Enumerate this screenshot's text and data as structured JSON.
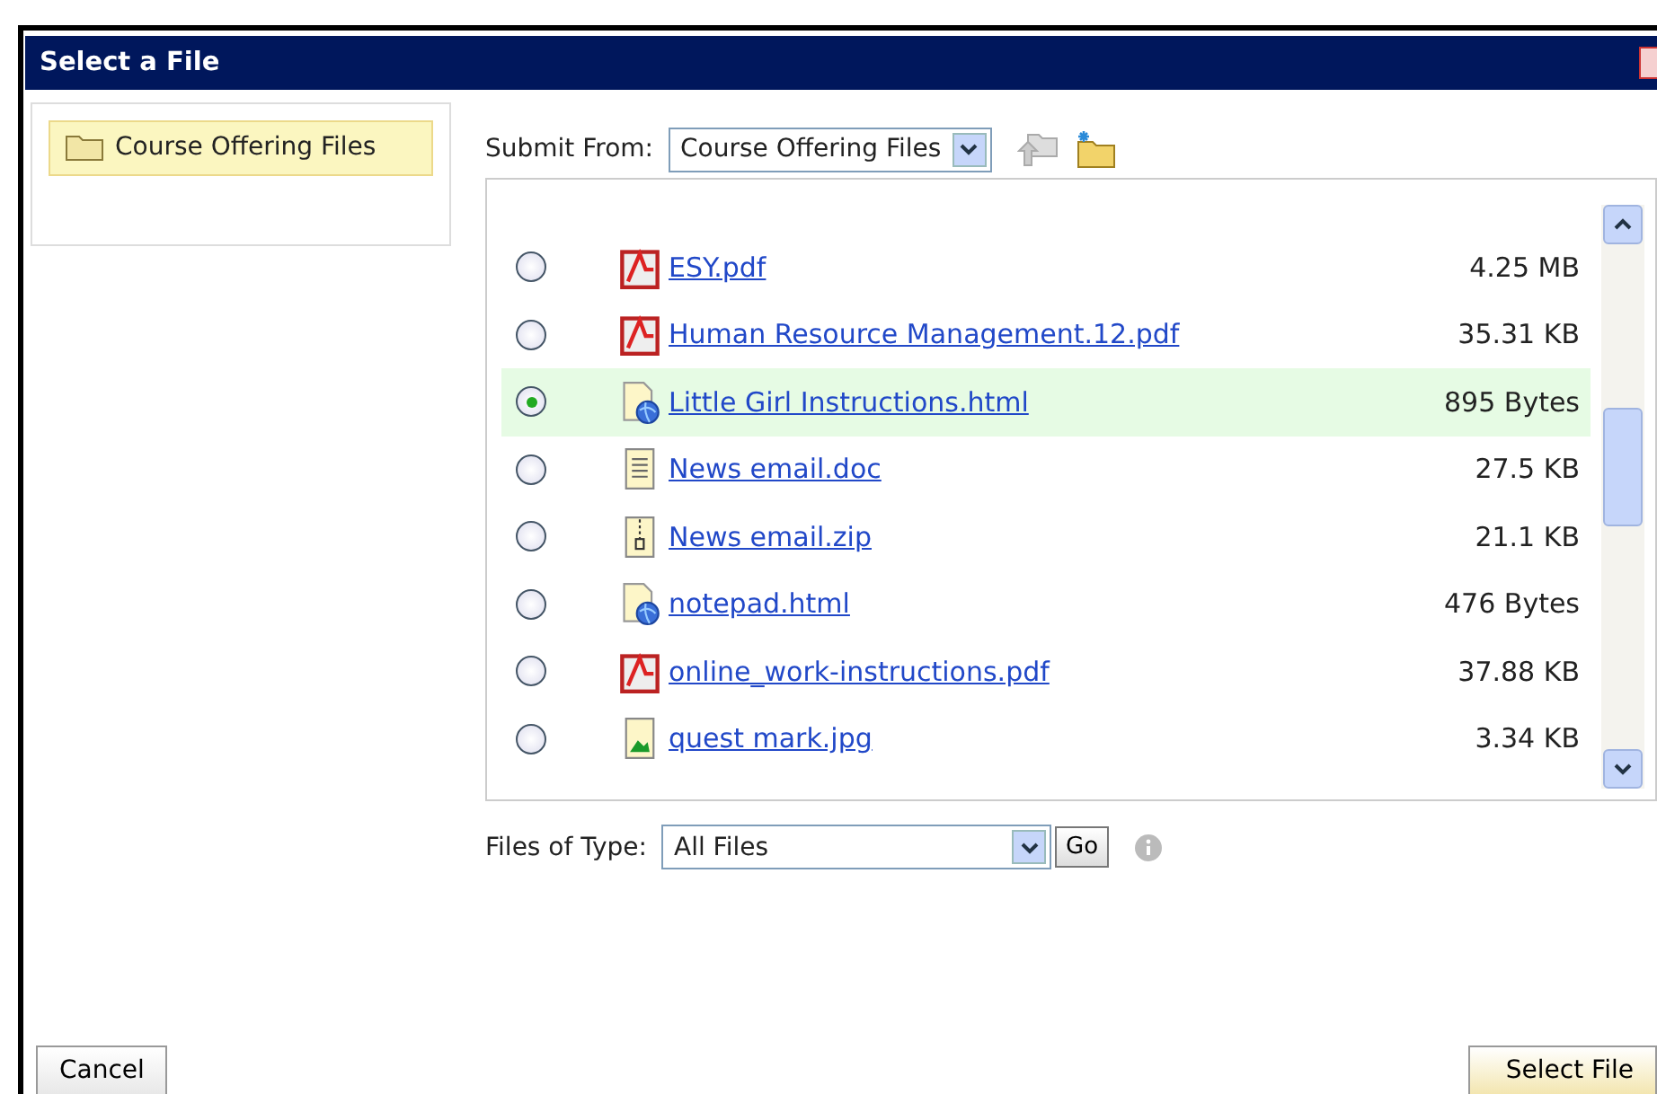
{
  "window": {
    "title": "Select a File"
  },
  "sidebar": {
    "items": [
      {
        "label": "Course Offering Files",
        "selected": true
      }
    ]
  },
  "submit_from": {
    "label": "Submit From:",
    "value": "Course Offering Files"
  },
  "files": [
    {
      "name": "ESY.pdf",
      "kind": "pdf",
      "size": "4.25 MB",
      "selected": false
    },
    {
      "name": "Human Resource Management.12.pdf",
      "kind": "pdf",
      "size": "35.31 KB",
      "selected": false
    },
    {
      "name": "Little Girl Instructions.html",
      "kind": "html",
      "size": "895 Bytes",
      "selected": true
    },
    {
      "name": "News email.doc",
      "kind": "doc",
      "size": "27.5 KB",
      "selected": false
    },
    {
      "name": "News email.zip",
      "kind": "zip",
      "size": "21.1 KB",
      "selected": false
    },
    {
      "name": "notepad.html",
      "kind": "html",
      "size": "476 Bytes",
      "selected": false
    },
    {
      "name": "online_work-instructions.pdf",
      "kind": "pdf",
      "size": "37.88 KB",
      "selected": false
    },
    {
      "name": "quest mark.jpg",
      "kind": "jpg",
      "size": "3.34 KB",
      "selected": false
    }
  ],
  "file_type": {
    "label": "Files of Type:",
    "value": "All Files",
    "go": "Go"
  },
  "buttons": {
    "cancel": "Cancel",
    "select": "Select File"
  }
}
